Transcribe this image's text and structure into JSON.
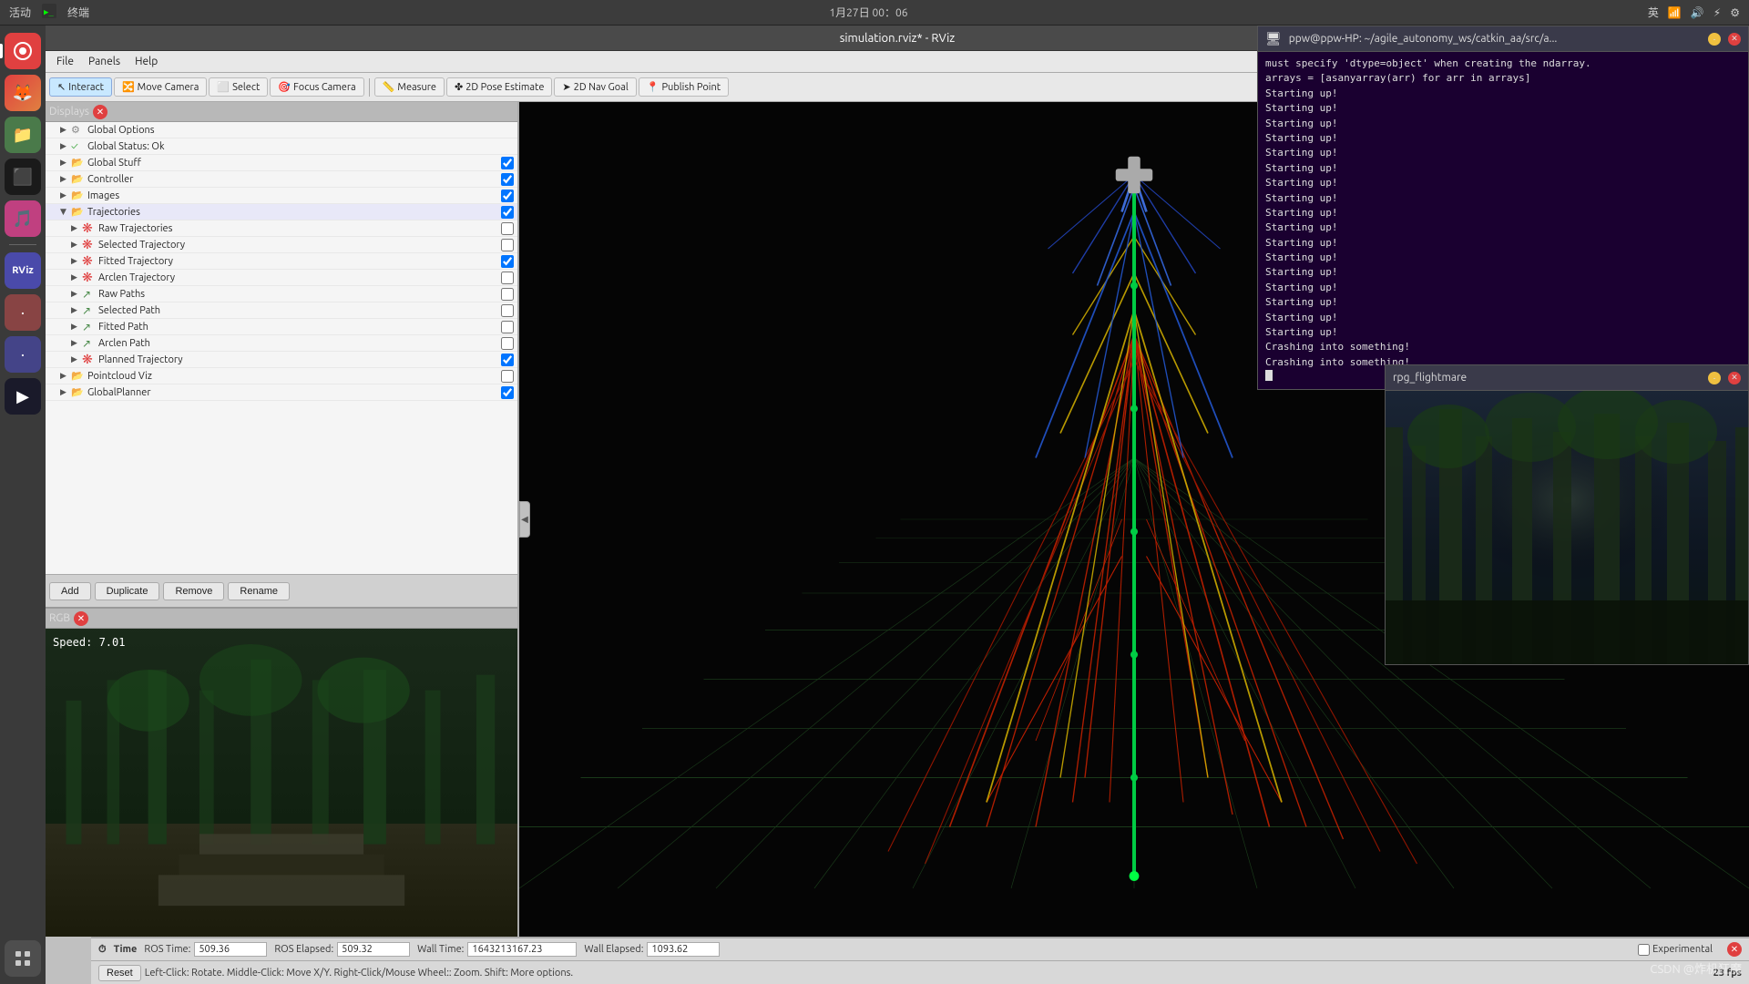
{
  "system": {
    "bar_left": "活动",
    "bar_left2": "终端",
    "datetime": "1月27日  00：06",
    "bar_right": "英",
    "bar_right2": "·",
    "bar_right3": "·",
    "bar_right4": "·"
  },
  "rviz": {
    "title": "simulation.rviz* - RViz",
    "menu": {
      "file": "File",
      "panels": "Panels",
      "help": "Help"
    },
    "toolbar": {
      "interact": "Interact",
      "move_camera": "Move Camera",
      "select": "Select",
      "focus_camera": "Focus Camera",
      "measure": "Measure",
      "pose_estimate": "2D Pose Estimate",
      "nav_goal": "2D Nav Goal",
      "publish_point": "Publish Point"
    },
    "displays": {
      "title": "Displays",
      "items": [
        {
          "label": "Global Options",
          "level": 1,
          "arrow": "▶",
          "icon": "⚙",
          "checked": false
        },
        {
          "label": "Global Status: Ok",
          "level": 1,
          "arrow": "▶",
          "icon": "✓",
          "checked": false
        },
        {
          "label": "Global Stuff",
          "level": 1,
          "arrow": "▶",
          "icon": "📁",
          "checked": true
        },
        {
          "label": "Controller",
          "level": 1,
          "arrow": "▶",
          "icon": "📁",
          "checked": true
        },
        {
          "label": "Images",
          "level": 1,
          "arrow": "▶",
          "icon": "📁",
          "checked": true
        },
        {
          "label": "Trajectories",
          "level": 1,
          "arrow": "▼",
          "icon": "📁",
          "checked": true
        },
        {
          "label": "Raw Trajectories",
          "level": 2,
          "arrow": "▶",
          "icon": "🌸",
          "checked": false
        },
        {
          "label": "Selected Trajectory",
          "level": 2,
          "arrow": "▶",
          "icon": "🌸",
          "checked": false
        },
        {
          "label": "Fitted Trajectory",
          "level": 2,
          "arrow": "▶",
          "icon": "🌸",
          "checked": true
        },
        {
          "label": "Arclen Trajectory",
          "level": 2,
          "arrow": "▶",
          "icon": "🌸",
          "checked": false
        },
        {
          "label": "Raw Paths",
          "level": 2,
          "arrow": "▶",
          "icon": "🌿",
          "checked": false
        },
        {
          "label": "Selected Path",
          "level": 2,
          "arrow": "▶",
          "icon": "🌿",
          "checked": false
        },
        {
          "label": "Fitted Path",
          "level": 2,
          "arrow": "▶",
          "icon": "🌿",
          "checked": false
        },
        {
          "label": "Arclen Path",
          "level": 2,
          "arrow": "▶",
          "icon": "🌿",
          "checked": false
        },
        {
          "label": "Planned Trajectory",
          "level": 2,
          "arrow": "▶",
          "icon": "🌸",
          "checked": true
        },
        {
          "label": "Pointcloud Viz",
          "level": 1,
          "arrow": "▶",
          "icon": "📁",
          "checked": false
        },
        {
          "label": "GlobalPlanner",
          "level": 1,
          "arrow": "▶",
          "icon": "📁",
          "checked": true
        }
      ],
      "add_btn": "Add",
      "duplicate_btn": "Duplicate",
      "remove_btn": "Remove",
      "rename_btn": "Rename"
    },
    "rgb": {
      "title": "RGB",
      "speed": "Speed: 7.01"
    },
    "time": {
      "title": "Time",
      "ros_time_label": "ROS Time:",
      "ros_time_val": "509.36",
      "ros_elapsed_label": "ROS Elapsed:",
      "ros_elapsed_val": "509.32",
      "wall_time_label": "Wall Time:",
      "wall_time_val": "1643213167.23",
      "wall_elapsed_label": "Wall Elapsed:",
      "wall_elapsed_val": "1093.62",
      "experimental": "Experimental",
      "reset": "Reset",
      "help": "Left-Click: Rotate.  Middle-Click: Move X/Y.  Right-Click/Mouse Wheel:: Zoom.  Shift: More options.",
      "fps": "23 fps"
    }
  },
  "terminal": {
    "title": "ppw@ppw-HP: ~/agile_autonomy_ws/catkin_aa/src/a...",
    "lines": [
      "must specify 'dtype=object' when creating the ndarray.",
      "arrays = [asanyarray(arr) for arr in arrays]",
      "Starting up!",
      "Starting up!",
      "Starting up!",
      "Starting up!",
      "Starting up!",
      "Starting up!",
      "Starting up!",
      "Starting up!",
      "Starting up!",
      "Starting up!",
      "Starting up!",
      "Starting up!",
      "Starting up!",
      "Starting up!",
      "Starting up!",
      "Starting up!",
      "Starting up!",
      "Crashing into something!",
      "Crashing into something!"
    ]
  },
  "flightmare": {
    "title": "rpg_flightmare"
  },
  "watermark": "CSDN @炸机狂魔"
}
